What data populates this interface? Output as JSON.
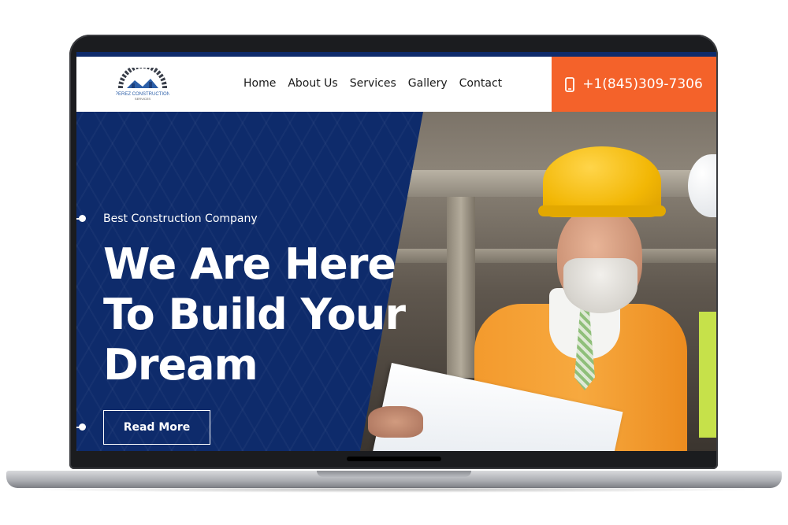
{
  "site": {
    "logo_text": "PEREZ CONSTRUCTION SERVICES",
    "nav": [
      "Home",
      "About Us",
      "Services",
      "Gallery",
      "Contact"
    ],
    "phone": "+1(845)309-7306"
  },
  "hero": {
    "tagline": "Best Construction Company",
    "headline_lines": [
      "We Are Here",
      "To Build Your",
      "Dream"
    ],
    "cta_label": "Read More"
  },
  "colors": {
    "navy": "#0e2b6b",
    "accent_orange": "#f4622a",
    "white": "#ffffff"
  },
  "icons": {
    "phone": "mobile-phone-icon",
    "logo": "house-gear-logo"
  }
}
